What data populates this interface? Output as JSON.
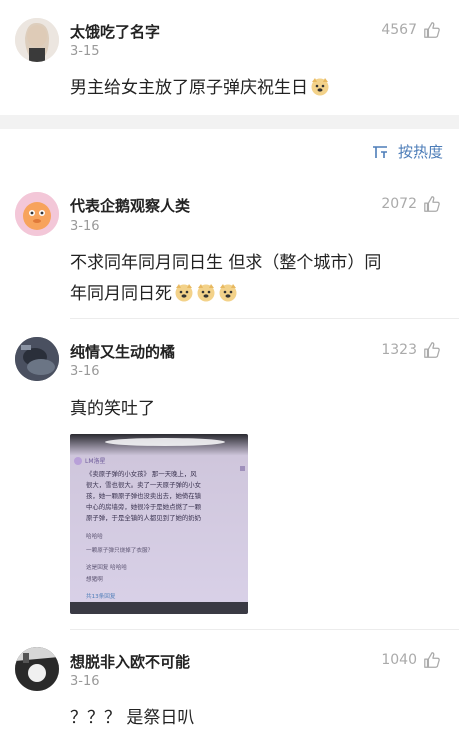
{
  "top_comment": {
    "username": "太饿吃了名字",
    "date": "3-15",
    "likes": "4567",
    "text": "男主给女主放了原子弹庆祝生日"
  },
  "sort": {
    "label": "按热度"
  },
  "comments": [
    {
      "username": "代表企鹅观察人类",
      "date": "3-16",
      "likes": "2072",
      "line1": "不求同年同月同日生 但求（整个城市）同",
      "line2": "年同月同日死"
    },
    {
      "username": "纯情又生动的橘",
      "date": "3-16",
      "likes": "1323",
      "text": "真的笑吐了"
    },
    {
      "username": "想脱非入欧不可能",
      "date": "3-16",
      "likes": "1040",
      "text": "？？？ 是祭日叭"
    }
  ],
  "embedded_image": {
    "author": "LM洛星",
    "lines": [
      "《卖原子弹的小女孩》 那一天晚上，风",
      "很大，雪也很大。卖了一天原子弹的小女",
      "孩，她一颗原子弹也没卖出去，她倚在镇",
      "中心的房墙旁，她很冷于是她点燃了一颗",
      "原子弹，于是全镇的人都见到了她的奶奶"
    ],
    "reply1": "哈哈哈",
    "reply2": "一颗原子弹只烧掉了衣服？",
    "reply3": "这是回复 哈哈哈",
    "reply4": "想猪啊",
    "footer": "共13条回复"
  },
  "colors": {
    "accent": "#4d7db8",
    "muted": "#999999",
    "divider": "#ececec"
  }
}
